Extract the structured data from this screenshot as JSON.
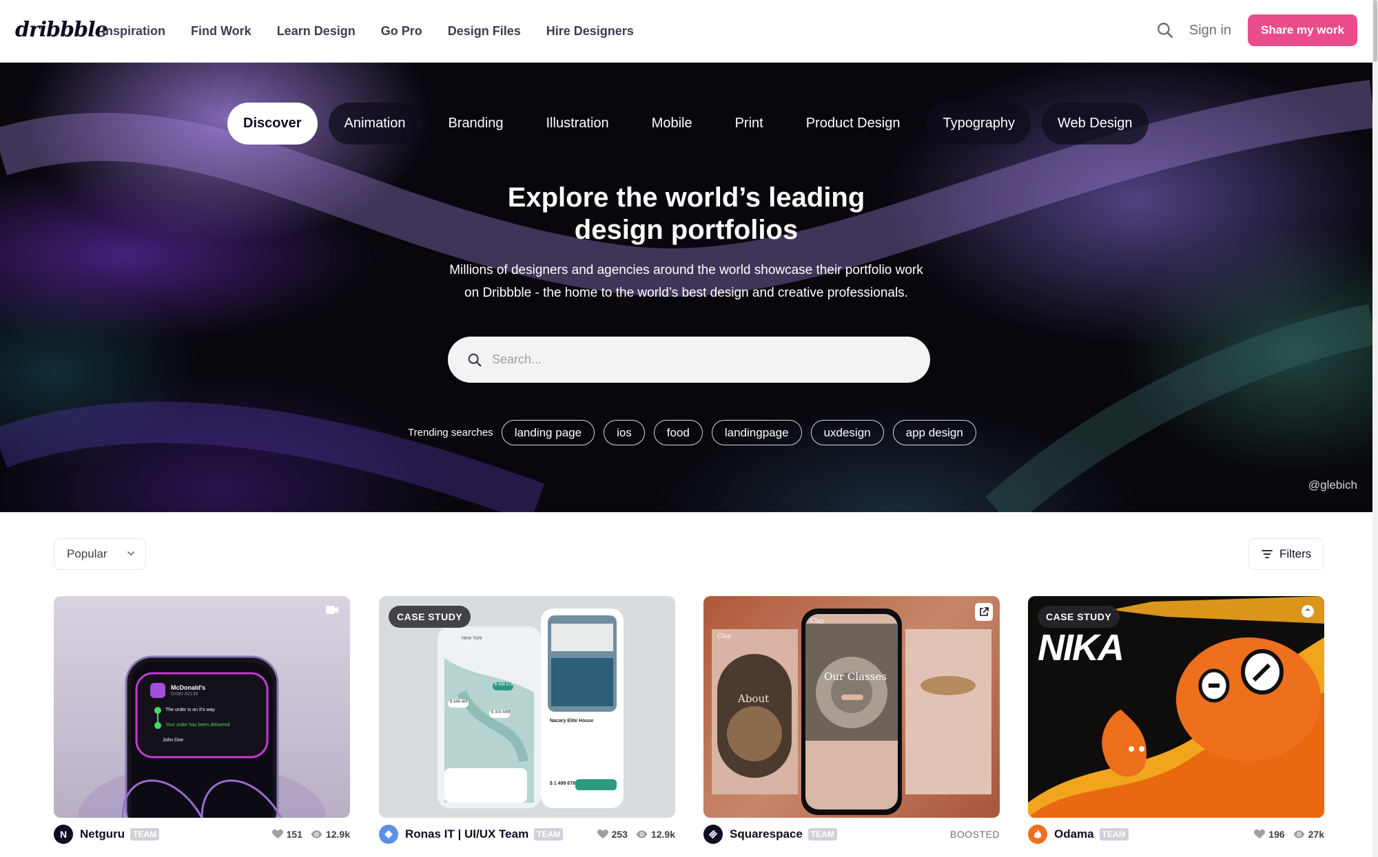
{
  "header": {
    "logo": "dribbble",
    "nav": [
      "Inspiration",
      "Find Work",
      "Learn Design",
      "Go Pro",
      "Design Files",
      "Hire Designers"
    ],
    "sign_in": "Sign in",
    "share": "Share my work"
  },
  "hero": {
    "categories": [
      "Discover",
      "Animation",
      "Branding",
      "Illustration",
      "Mobile",
      "Print",
      "Product Design",
      "Typography",
      "Web Design"
    ],
    "title_line1": "Explore the world’s leading",
    "title_line2": "design portfolios",
    "subtitle_line1": "Millions of designers and agencies around the world showcase their portfolio work",
    "subtitle_line2": "on Dribbble - the home to the world’s best design and creative professionals.",
    "search_placeholder": "Search...",
    "trending_label": "Trending searches",
    "trending": [
      "landing page",
      "ios",
      "food",
      "landingpage",
      "uxdesign",
      "app design"
    ],
    "credit": "@glebich"
  },
  "filters": {
    "sort": "Popular",
    "filters_label": "Filters"
  },
  "shots": [
    {
      "author": "Netguru",
      "avatar_letter": "N",
      "team": "TEAM",
      "likes": "151",
      "views": "12.9k",
      "badge": "",
      "mock": {
        "brand": "McDonald's",
        "order": "Order #2138",
        "step1": "The order is on it's way",
        "step2": "Your order has been delivered",
        "user": "John Doe"
      }
    },
    {
      "author": "Ronas IT | UI/UX Team",
      "avatar_letter": "",
      "team": "TEAM",
      "likes": "253",
      "views": "12.9k",
      "badge": "CASE STUDY",
      "mock": {
        "search": "New York",
        "house": "Nacary Elite House",
        "price": "$ 1 499 678",
        "tags": [
          "$ 499 678",
          "$ 649 4M",
          "$ 300 MW"
        ]
      }
    },
    {
      "author": "Squarespace",
      "avatar_letter": "",
      "team": "TEAM",
      "boosted": "BOOSTED",
      "badge": "",
      "mock": {
        "brand": "Clay",
        "about": "About",
        "classes": "Our Classes"
      }
    },
    {
      "author": "Odama",
      "avatar_letter": "",
      "team": "TEAM",
      "likes": "196",
      "views": "27k",
      "badge": "CASE STUDY",
      "mock": {
        "word": "NIKA"
      }
    }
  ],
  "colors": {
    "brand_pink": "#ea4c89",
    "text": "#0d0c22"
  }
}
